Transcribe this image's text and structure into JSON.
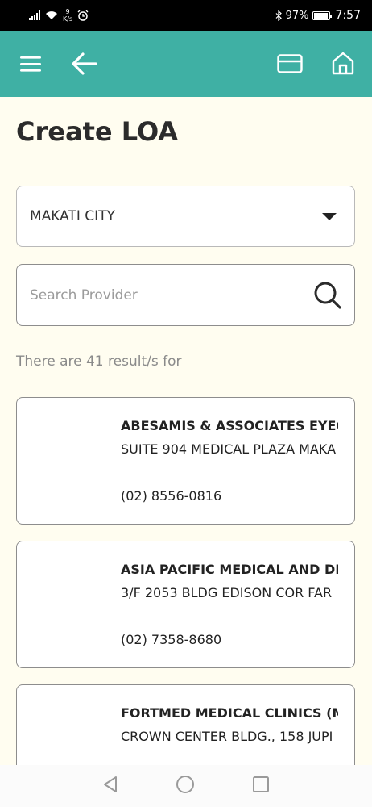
{
  "status_bar": {
    "net_speed_value": "9",
    "net_speed_unit": "K/s",
    "battery": "97%",
    "battery_level": 0.97,
    "time": "7:57"
  },
  "app_bar": {
    "background": "#3fb0a4",
    "icons": [
      "menu-icon",
      "back-arrow-icon",
      "card-icon",
      "home-icon"
    ]
  },
  "page": {
    "title": "Create LOA"
  },
  "city_select": {
    "value": "MAKATI CITY"
  },
  "search": {
    "placeholder": "Search Provider",
    "value": ""
  },
  "results": {
    "text": "There are 41 result/s for"
  },
  "providers": [
    {
      "name": "ABESAMIS & ASSOCIATES EYECA",
      "address": "SUITE 904 MEDICAL PLAZA MAKA",
      "phone": "(02) 8556-0816"
    },
    {
      "name": "ASIA PACIFIC MEDICAL AND DIA",
      "address": "3/F 2053 BLDG EDISON COR FAR",
      "phone": "(02) 7358-8680"
    },
    {
      "name": "FORTMED MEDICAL CLINICS (MA",
      "address": "CROWN CENTER BLDG., 158 JUPI",
      "phone": ""
    }
  ]
}
